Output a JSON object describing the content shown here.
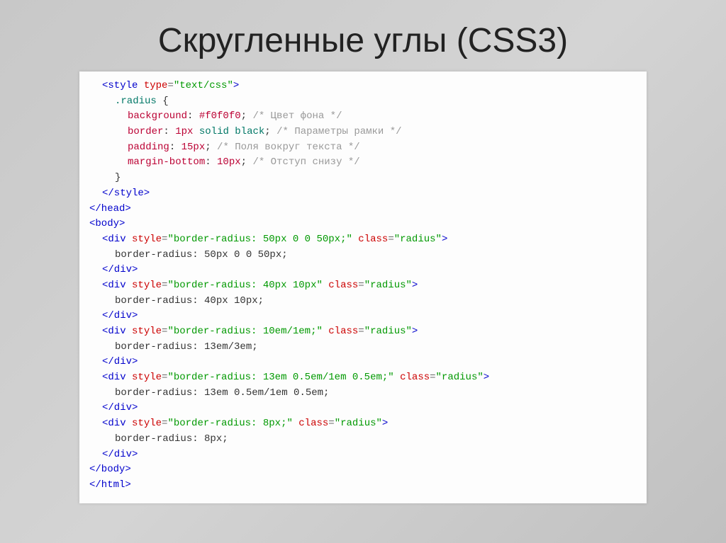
{
  "title": "Скругленные углы (CSS3)",
  "code": {
    "styleOpenTag": "<style",
    "styleTypeAttr": "type",
    "styleTypeVal": "\"text/css\"",
    "tagClose": ">",
    "selector": ".radius",
    "braceOpen": "{",
    "braceClose": "}",
    "props": [
      {
        "name": "background",
        "valColor": "#f0f0f0",
        "semi": ";",
        "comment": "/* Цвет фона */"
      },
      {
        "name": "border",
        "valNum": "1px",
        "valKw1": "solid",
        "valKw2": "black",
        "semi": ";",
        "comment": "/* Параметры рамки */"
      },
      {
        "name": "padding",
        "valNum": "15px",
        "semi": ";",
        "comment": "/* Поля вокруг текста */"
      },
      {
        "name": "margin-bottom",
        "valNum": "10px",
        "semi": ";",
        "comment": "/* Отступ снизу */"
      }
    ],
    "styleCloseTag": "</style>",
    "headClose": "</head>",
    "bodyOpen": "<body>",
    "bodyClose": "</body>",
    "htmlClose": "</html>",
    "divs": [
      {
        "styleVal": "\"border-radius: 50px 0 0 50px;\"",
        "classVal": "\"radius\"",
        "inner": "border-radius: 50px 0 0 50px;"
      },
      {
        "styleVal": "\"border-radius: 40px 10px\"",
        "classVal": "\"radius\"",
        "inner": "border-radius: 40px 10px;"
      },
      {
        "styleVal": "\"border-radius: 10em/1em;\"",
        "classVal": "\"radius\"",
        "inner": "border-radius: 13em/3em;"
      },
      {
        "styleVal": "\"border-radius: 13em 0.5em/1em 0.5em;\"",
        "classVal": "\"radius\"",
        "inner": "border-radius: 13em 0.5em/1em 0.5em;"
      },
      {
        "styleVal": "\"border-radius: 8px;\"",
        "classVal": "\"radius\"",
        "inner": "border-radius: 8px;"
      }
    ],
    "divOpen": "<div",
    "divClose": "</div>",
    "styleAttr": "style",
    "classAttr": "class",
    "eq": "="
  }
}
